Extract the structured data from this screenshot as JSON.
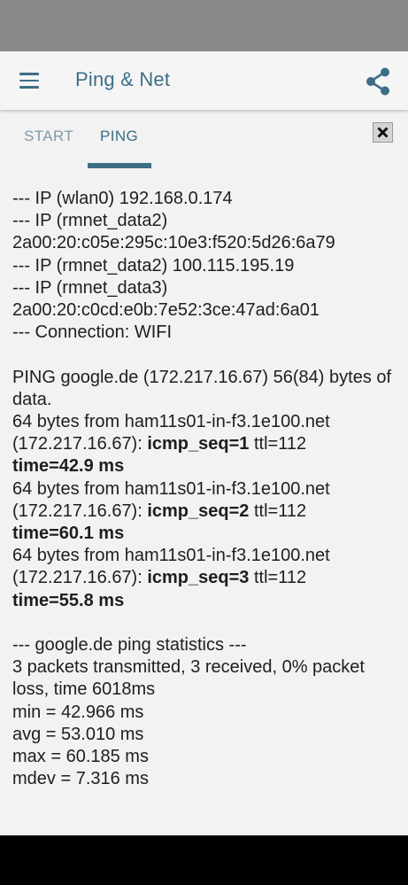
{
  "app": {
    "title": "Ping & Net",
    "menu_icon": "hamburger-menu-icon",
    "share_icon": "share-icon",
    "accent_color": "#3d6e86"
  },
  "tabs": [
    {
      "label": "START",
      "active": false
    },
    {
      "label": "PING",
      "active": true
    }
  ],
  "close_icon": "close-x-icon",
  "network": {
    "wlan0_line": "--- IP (wlan0) 192.168.0.174",
    "rmnet2_header": "--- IP (rmnet_data2)",
    "rmnet2_ipv6": "2a00:20:c05e:295c:10e3:f520:5d26:6a79",
    "rmnet2_ipv4_line": "--- IP (rmnet_data2) 100.115.195.19",
    "rmnet3_header": "--- IP (rmnet_data3)",
    "rmnet3_ipv6": "2a00:20:c0cd:e0b:7e52:3ce:47ad:6a01",
    "connection_line": "--- Connection: WIFI"
  },
  "ping": {
    "header": "PING google.de (172.217.16.67) 56(84) bytes of data.",
    "replies": [
      {
        "from": "64 bytes from ham11s01-in-f3.1e100.net",
        "ip": "(172.217.16.67): ",
        "seq": "icmp_seq=1",
        "ttl": " ttl=112",
        "time": "time=42.9 ms"
      },
      {
        "from": "64 bytes from ham11s01-in-f3.1e100.net",
        "ip": "(172.217.16.67): ",
        "seq": "icmp_seq=2",
        "ttl": " ttl=112",
        "time": "time=60.1 ms"
      },
      {
        "from": "64 bytes from ham11s01-in-f3.1e100.net",
        "ip": "(172.217.16.67): ",
        "seq": "icmp_seq=3",
        "ttl": " ttl=112",
        "time": "time=55.8 ms"
      }
    ]
  },
  "statistics": {
    "header": "--- google.de ping statistics ---",
    "summary": "3 packets transmitted, 3 received, 0% packet loss, time 6018ms",
    "min": "min = 42.966 ms",
    "avg": "avg = 53.010 ms",
    "max": "max = 60.185 ms",
    "mdev": "mdev = 7.316 ms"
  }
}
